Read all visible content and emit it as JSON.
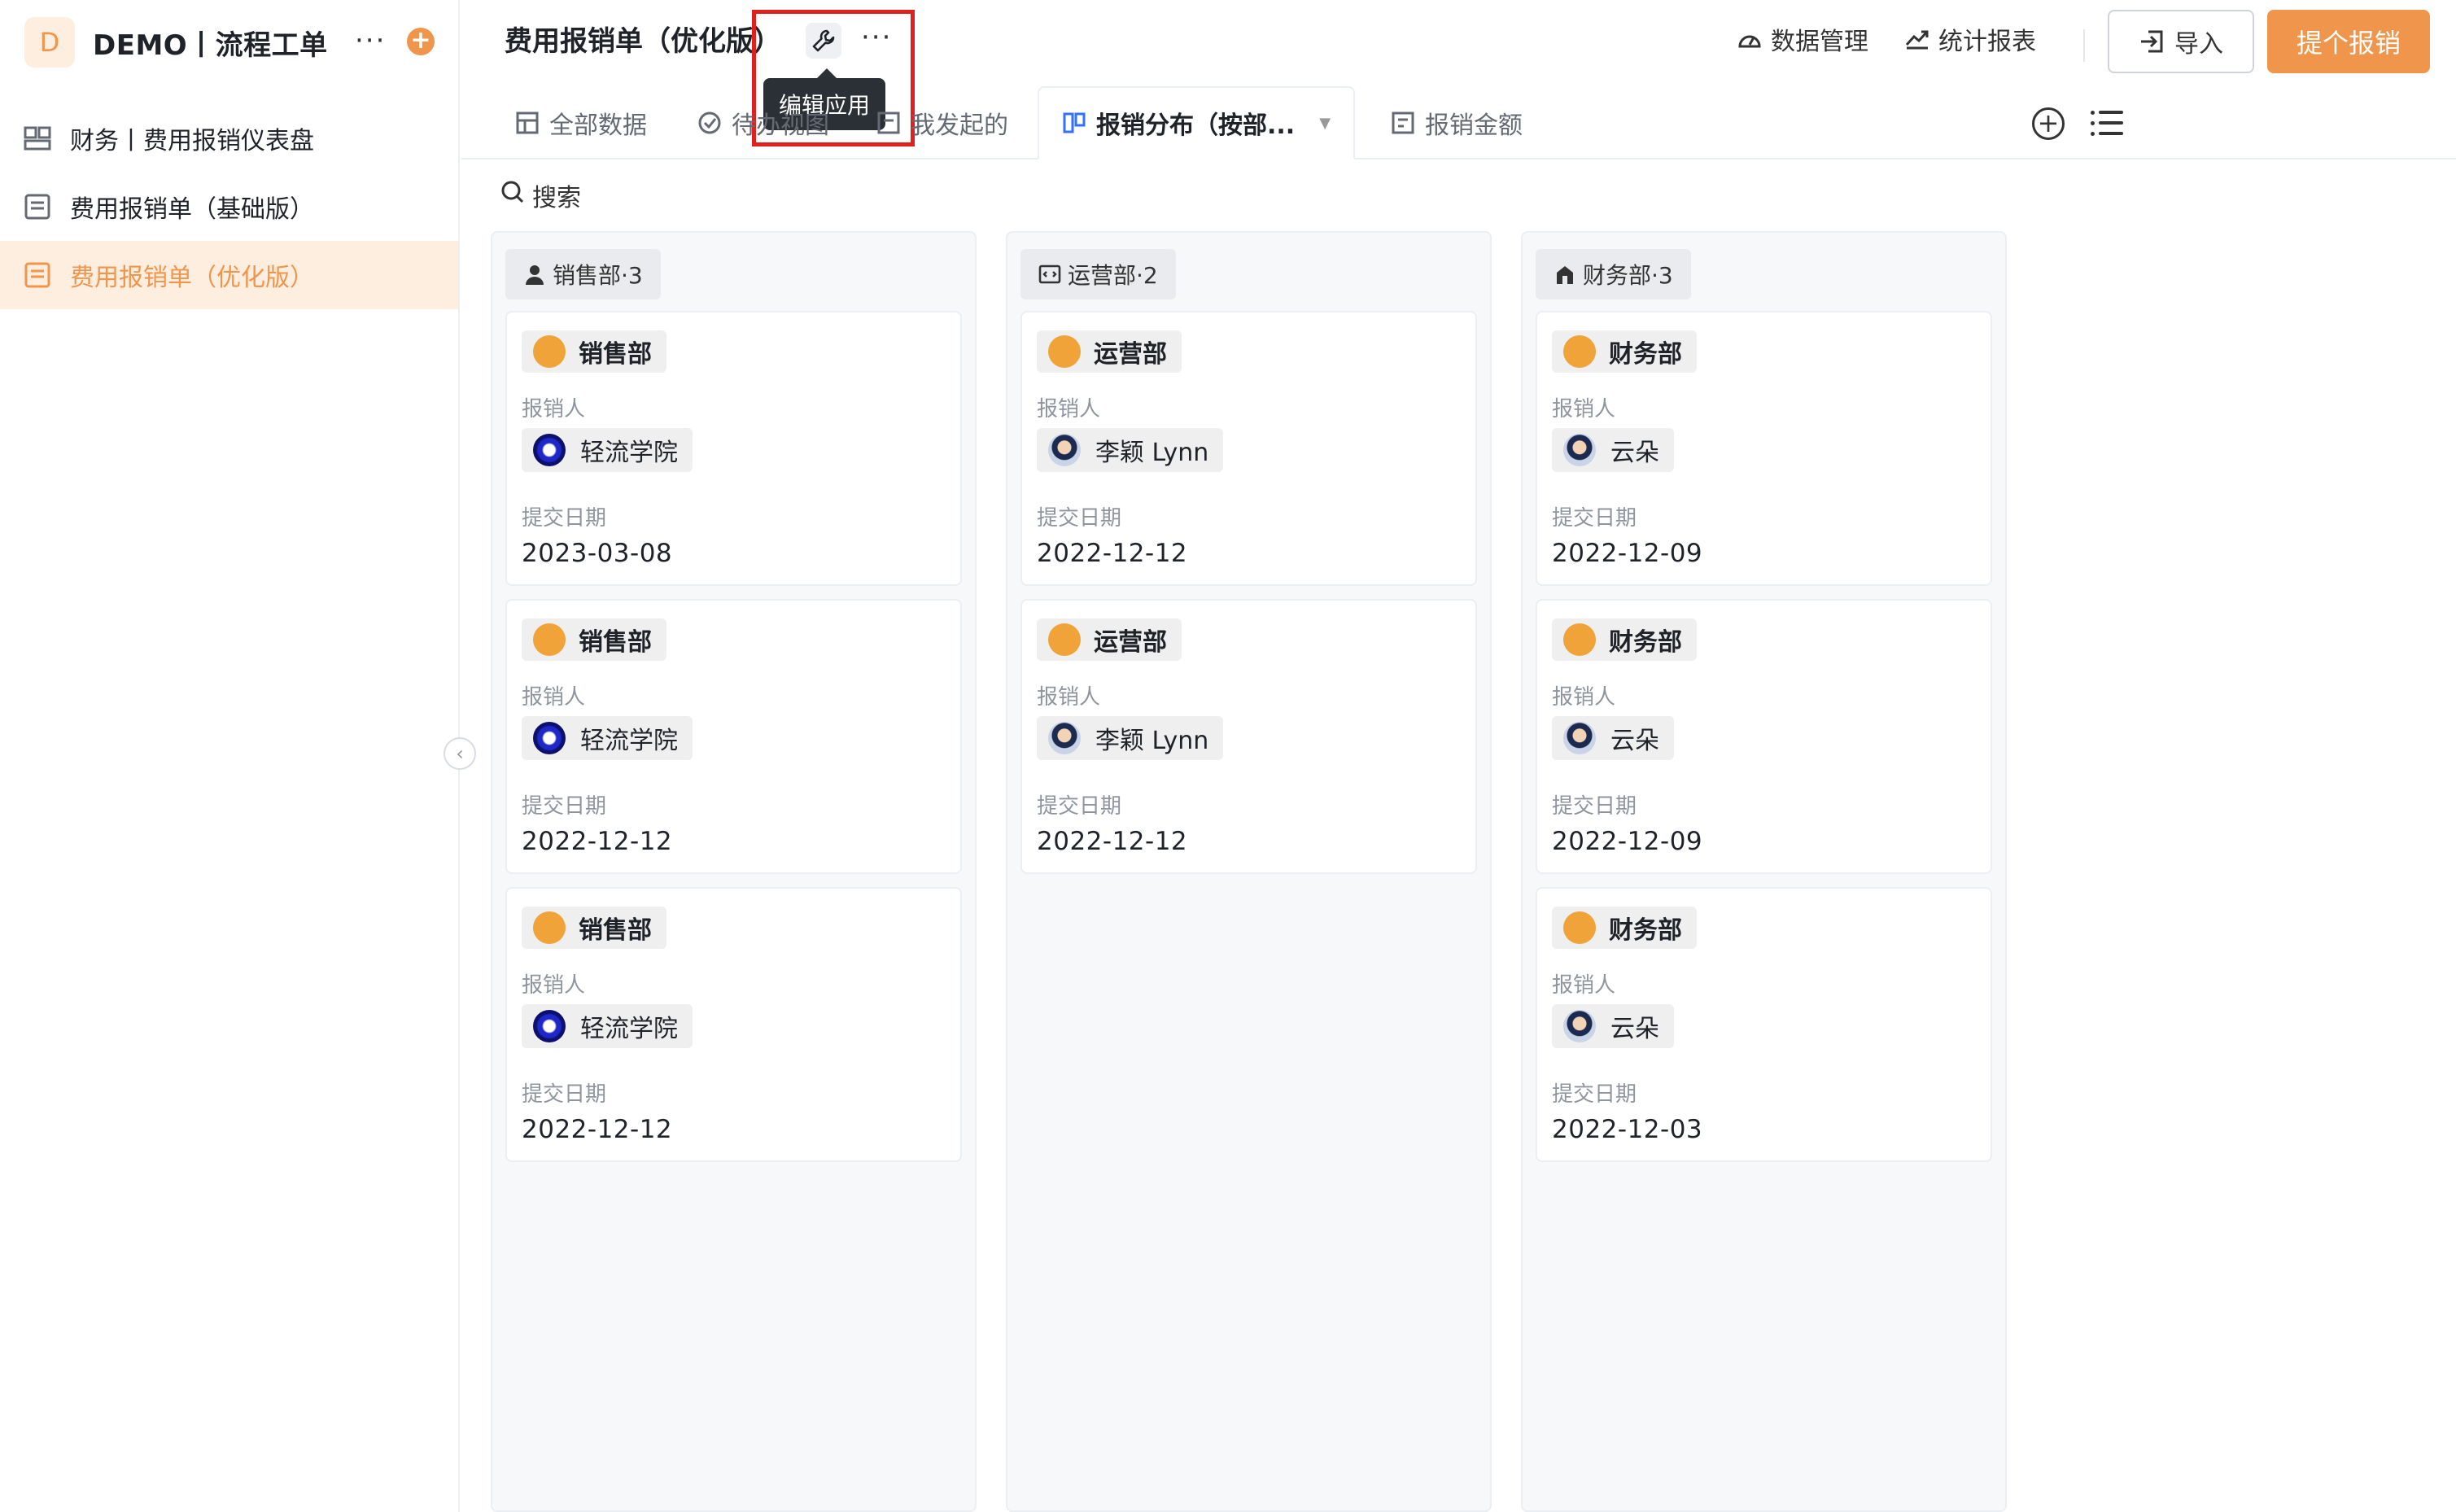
{
  "app": {
    "logo_letter": "D",
    "title": "DEMO丨流程工单",
    "more": "···",
    "add": "+"
  },
  "sidebar": {
    "items": [
      {
        "label": "财务丨费用报销仪表盘",
        "icon": "dashboard-icon"
      },
      {
        "label": "费用报销单（基础版）",
        "icon": "form-icon"
      },
      {
        "label": "费用报销单（优化版）",
        "icon": "form-icon"
      }
    ],
    "collapse": "‹"
  },
  "header": {
    "title": "费用报销单（优化版）",
    "more": "···",
    "tooltip": "编辑应用",
    "data_manage": "数据管理",
    "stats": "统计报表",
    "import": "导入",
    "submit": "提个报销"
  },
  "tabs": [
    {
      "label": "全部数据",
      "icon": "table-icon"
    },
    {
      "label": "待办视图",
      "icon": "check-icon"
    },
    {
      "label": "我发起的",
      "icon": "user-form-icon"
    },
    {
      "label": "报销分布（按部...",
      "icon": "kanban-icon"
    },
    {
      "label": "报销金额",
      "icon": "chart-icon"
    }
  ],
  "search": {
    "label": "搜索"
  },
  "labels": {
    "reimburser": "报销人",
    "submit_date": "提交日期"
  },
  "columns": [
    {
      "name": "销售部·3",
      "cards": [
        {
          "dept": "销售部",
          "person": "轻流学院",
          "date": "2023-03-08"
        },
        {
          "dept": "销售部",
          "person": "轻流学院",
          "date": "2022-12-12"
        },
        {
          "dept": "销售部",
          "person": "轻流学院",
          "date": "2022-12-12"
        }
      ]
    },
    {
      "name": "运营部·2",
      "cards": [
        {
          "dept": "运营部",
          "person": "李颖 Lynn",
          "date": "2022-12-12"
        },
        {
          "dept": "运营部",
          "person": "李颖 Lynn",
          "date": "2022-12-12"
        }
      ]
    },
    {
      "name": "财务部·3",
      "cards": [
        {
          "dept": "财务部",
          "person": "云朵",
          "date": "2022-12-09"
        },
        {
          "dept": "财务部",
          "person": "云朵",
          "date": "2022-12-09"
        },
        {
          "dept": "财务部",
          "person": "云朵",
          "date": "2022-12-03"
        }
      ]
    }
  ],
  "colors": {
    "accent": "#f0954c",
    "highlight": "#e0201f",
    "tab_active_icon": "#3370ff"
  }
}
